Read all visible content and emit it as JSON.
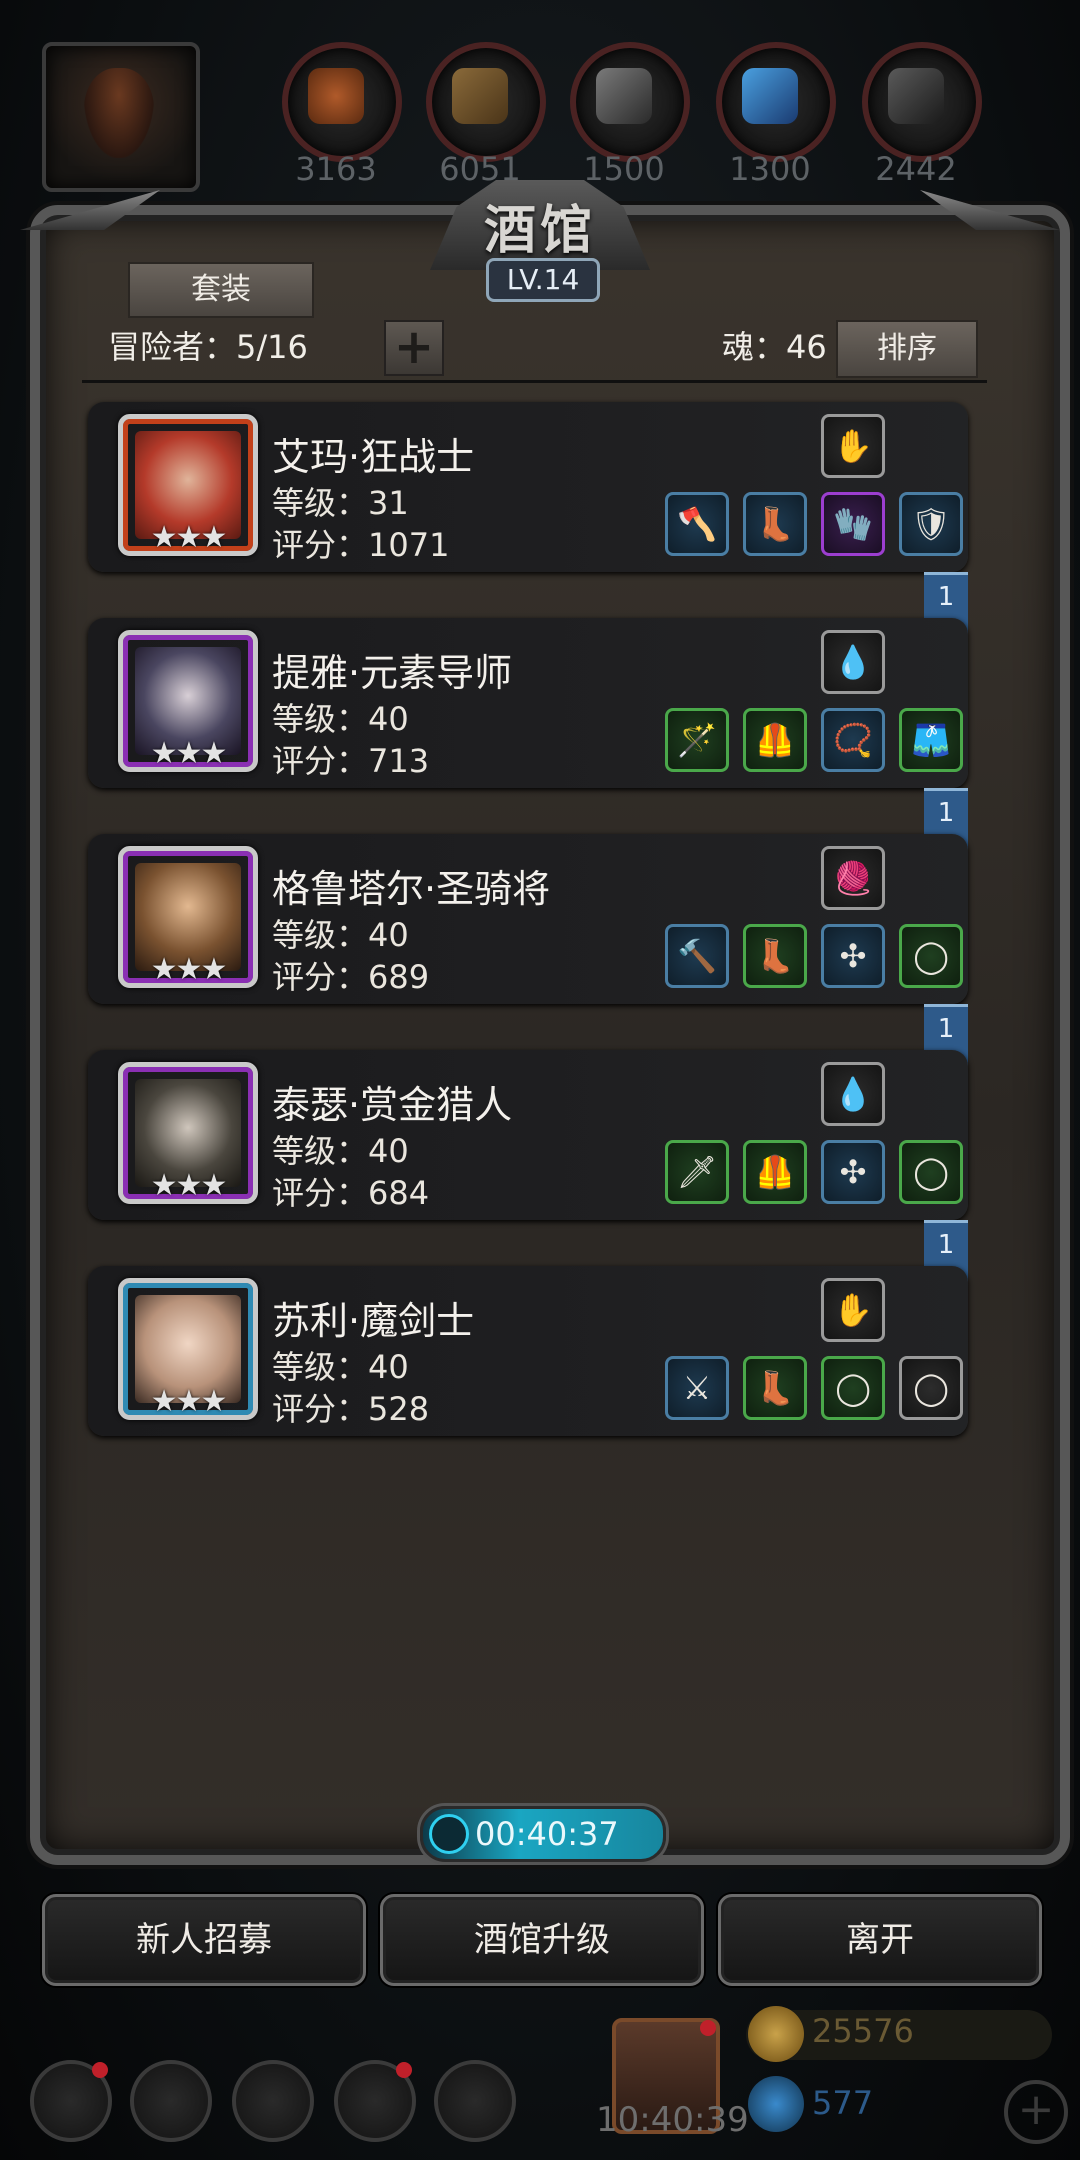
{
  "resources": [
    {
      "value": "3163",
      "color": "#8a3a1a"
    },
    {
      "value": "6051",
      "color": "#7a5a2a"
    },
    {
      "value": "1500",
      "color": "#555555"
    },
    {
      "value": "1300",
      "color": "#2a70b0"
    },
    {
      "value": "2442",
      "color": "#444444"
    }
  ],
  "panel": {
    "title": "酒馆",
    "level": "LV.14",
    "set_button": "套装",
    "adventurer_label": "冒险者：5/16",
    "add_label": "+",
    "soul_label": "魂：46",
    "sort_button": "排序"
  },
  "heroes": [
    {
      "name": "艾玛·狂战士",
      "level": "等级：31",
      "score": "评分：1071",
      "stars": "★★★",
      "frame_color": "#c2401a"
    },
    {
      "name": "提雅·元素导师",
      "level": "等级：40",
      "score": "评分：713",
      "stars": "★★★",
      "frame_color": "#8a2fb3"
    },
    {
      "name": "格鲁塔尔·圣骑将",
      "level": "等级：40",
      "score": "评分：689",
      "stars": "★★★",
      "frame_color": "#8a2fb3"
    },
    {
      "name": "泰瑟·赏金猎人",
      "level": "等级：40",
      "score": "评分：684",
      "stars": "★★★",
      "frame_color": "#8a2fb3"
    },
    {
      "name": "苏利·魔剑士",
      "level": "等级：40",
      "score": "评分：528",
      "stars": "★★★",
      "frame_color": "#2f8ab3"
    }
  ],
  "bookmark_badge": "1",
  "timer": "00:40:37",
  "actions": {
    "recruit": "新人招募",
    "upgrade": "酒馆升级",
    "leave": "离开"
  },
  "hud": {
    "clock": "10:40:39",
    "gold": "25576",
    "gems": "577"
  }
}
